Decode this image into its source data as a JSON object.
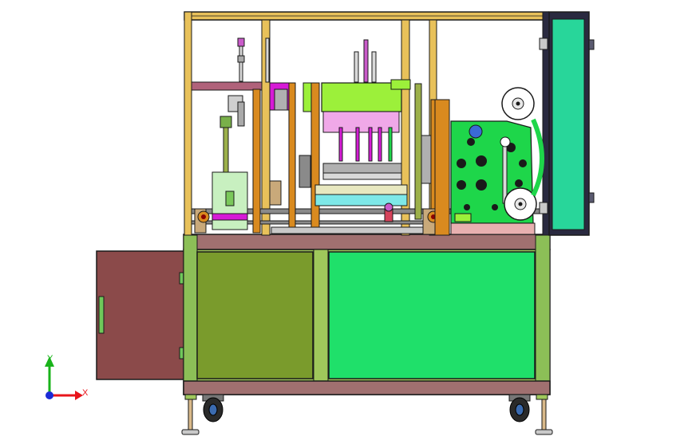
{
  "viewport": {
    "background": "#ffffff"
  },
  "triad": {
    "x_label": "X",
    "y_label": "Y",
    "x_color": "#e8141b",
    "y_color": "#19b31a",
    "z_color": "#1b2bd6"
  },
  "palette": {
    "frame_yellow": "#e8c15a",
    "frame_orange": "#d98a1f",
    "steel_gray": "#8a8a8a",
    "dark_edge": "#1a1a1a",
    "cabinet_olive": "#7a9b2c",
    "cabinet_green": "#1fe06a",
    "cabinet_base": "#9fc75b",
    "side_door": "#8b4a4a",
    "top_panel": "#a07070",
    "teal_door": "#28d69a",
    "magenta": "#d61bd6",
    "lime": "#9cf03a",
    "pink": "#f0a8e8",
    "cyan": "#7ee8e8",
    "mech_green": "#1ed64a",
    "blue_accent": "#3a6ad6",
    "white": "#ffffff"
  }
}
